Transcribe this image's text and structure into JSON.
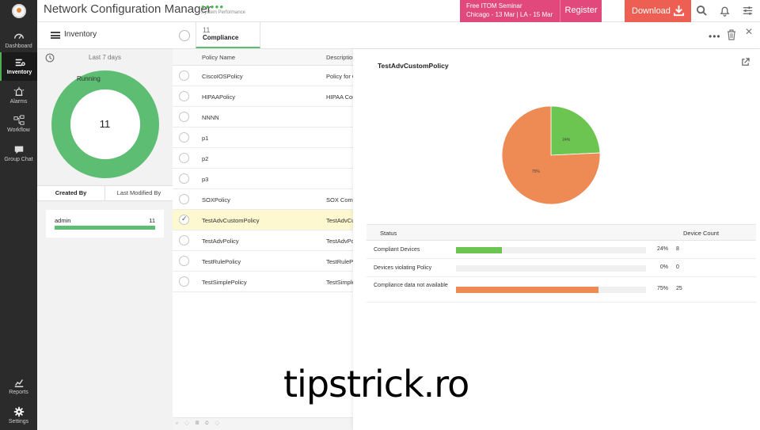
{
  "app": {
    "title": "Network Configuration Manager",
    "system_performance_dots": "●●●●●",
    "system_performance_label": "System Performance"
  },
  "banner": {
    "seminar_line1": "Free ITOM Seminar",
    "seminar_line2": "Chicago - 13 Mar | LA - 15 Mar",
    "register_label": "Register",
    "download_label": "Download"
  },
  "sidebar": {
    "items": [
      {
        "label": "Dashboard",
        "icon": "speedometer-icon"
      },
      {
        "label": "Inventory",
        "icon": "inventory-icon",
        "active": true
      },
      {
        "label": "Alarms",
        "icon": "alarm-icon"
      },
      {
        "label": "Workflow",
        "icon": "workflow-icon"
      },
      {
        "label": "Group Chat",
        "icon": "chat-icon"
      }
    ],
    "bottom": [
      {
        "label": "Reports",
        "icon": "reports-icon"
      },
      {
        "label": "Settings",
        "icon": "gear-icon"
      }
    ]
  },
  "inventory": {
    "title": "Inventory",
    "period": "Last 7 days",
    "running_label": "Running",
    "running_value": "11",
    "tab_created_by": "Created By",
    "tab_last_modified": "Last Modified By",
    "users": [
      {
        "name": "admin",
        "count": "11"
      }
    ]
  },
  "compliance_tab": {
    "count": "11",
    "label": "Compliance"
  },
  "policy_list": {
    "col_name": "Policy Name",
    "col_desc": "Description",
    "rows": [
      {
        "name": "CiscoIOSPolicy",
        "desc": "Policy for C"
      },
      {
        "name": "HIPAAPolicy",
        "desc": "HIPAA Com"
      },
      {
        "name": "NNNN",
        "desc": ""
      },
      {
        "name": "p1",
        "desc": ""
      },
      {
        "name": "p2",
        "desc": ""
      },
      {
        "name": "p3",
        "desc": ""
      },
      {
        "name": "SOXPolicy",
        "desc": "SOX Comp"
      },
      {
        "name": "TestAdvCustomPolicy",
        "desc": "TestAdvCu",
        "selected": true
      },
      {
        "name": "TestAdvPolicy",
        "desc": "TestAdvPo"
      },
      {
        "name": "TestRulePolicy",
        "desc": "TestRulePo"
      },
      {
        "name": "TestSimplePolicy",
        "desc": "TestSimple"
      }
    ],
    "footer": "⌕ ◇ ▦ ◎ ◇"
  },
  "detail": {
    "title": "TestAdvCustomPolicy",
    "status_header": "Status",
    "count_header": "Device Count",
    "pie_labels": [
      "24%",
      "75%"
    ],
    "rows": [
      {
        "label": "Compliant Devices",
        "pct": "24%",
        "fraction": 0.24,
        "count": "8",
        "color": "#6cc551"
      },
      {
        "label": "Devices violating Policy",
        "pct": "0%",
        "fraction": 0.0,
        "count": "0",
        "color": "#e74c3c"
      },
      {
        "label": "Compliance data not available",
        "pct": "75%",
        "fraction": 0.75,
        "count": "25",
        "color": "#ee8a54"
      }
    ]
  },
  "watermark": "tipstrick.ro"
}
